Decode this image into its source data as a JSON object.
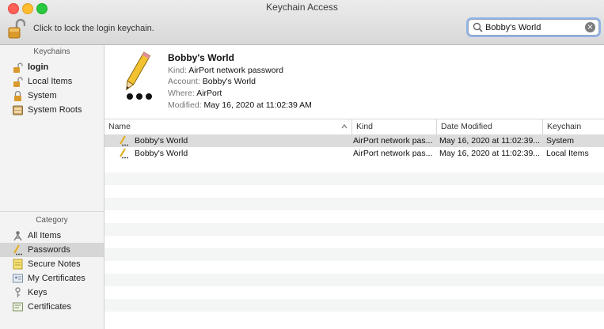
{
  "window": {
    "title": "Keychain Access"
  },
  "toolbar": {
    "lock_label": "Click to lock the login keychain.",
    "search_value": "Bobby's World",
    "clear_symbol": "×"
  },
  "sidebar": {
    "keychains_header": "Keychains",
    "keychains": [
      {
        "label": "login",
        "icon": "unlocked-padlock-icon",
        "bold": true
      },
      {
        "label": "Local Items",
        "icon": "unlocked-padlock-icon"
      },
      {
        "label": "System",
        "icon": "padlock-icon"
      },
      {
        "label": "System Roots",
        "icon": "cabinet-icon"
      }
    ],
    "category_header": "Category",
    "categories": [
      {
        "label": "All Items",
        "icon": "people-icon"
      },
      {
        "label": "Passwords",
        "icon": "pencil-dots-icon",
        "selected": true
      },
      {
        "label": "Secure Notes",
        "icon": "note-icon"
      },
      {
        "label": "My Certificates",
        "icon": "certificate-person-icon"
      },
      {
        "label": "Keys",
        "icon": "key-icon"
      },
      {
        "label": "Certificates",
        "icon": "certificate-icon"
      }
    ]
  },
  "detail": {
    "name": "Bobby's World",
    "kind_label": "Kind:",
    "kind_value": "AirPort network password",
    "account_label": "Account:",
    "account_value": "Bobby's World",
    "where_label": "Where:",
    "where_value": "AirPort",
    "modified_label": "Modified:",
    "modified_value": "May 16, 2020 at 11:02:39 AM"
  },
  "table": {
    "columns": [
      "Name",
      "Kind",
      "Date Modified",
      "Keychain"
    ],
    "sort_column": "Name",
    "rows": [
      {
        "name": "Bobby's World",
        "kind": "AirPort network pas...",
        "date": "May 16, 2020 at 11:02:39...",
        "keychain": "System",
        "selected": true
      },
      {
        "name": "Bobby's World",
        "kind": "AirPort network pas...",
        "date": "May 16, 2020 at 11:02:39...",
        "keychain": "Local Items"
      }
    ]
  },
  "colors": {
    "selection": "#dcdcdc",
    "search_focus_ring": "#8fb3e8",
    "pencil_yellow": "#f2c230"
  }
}
